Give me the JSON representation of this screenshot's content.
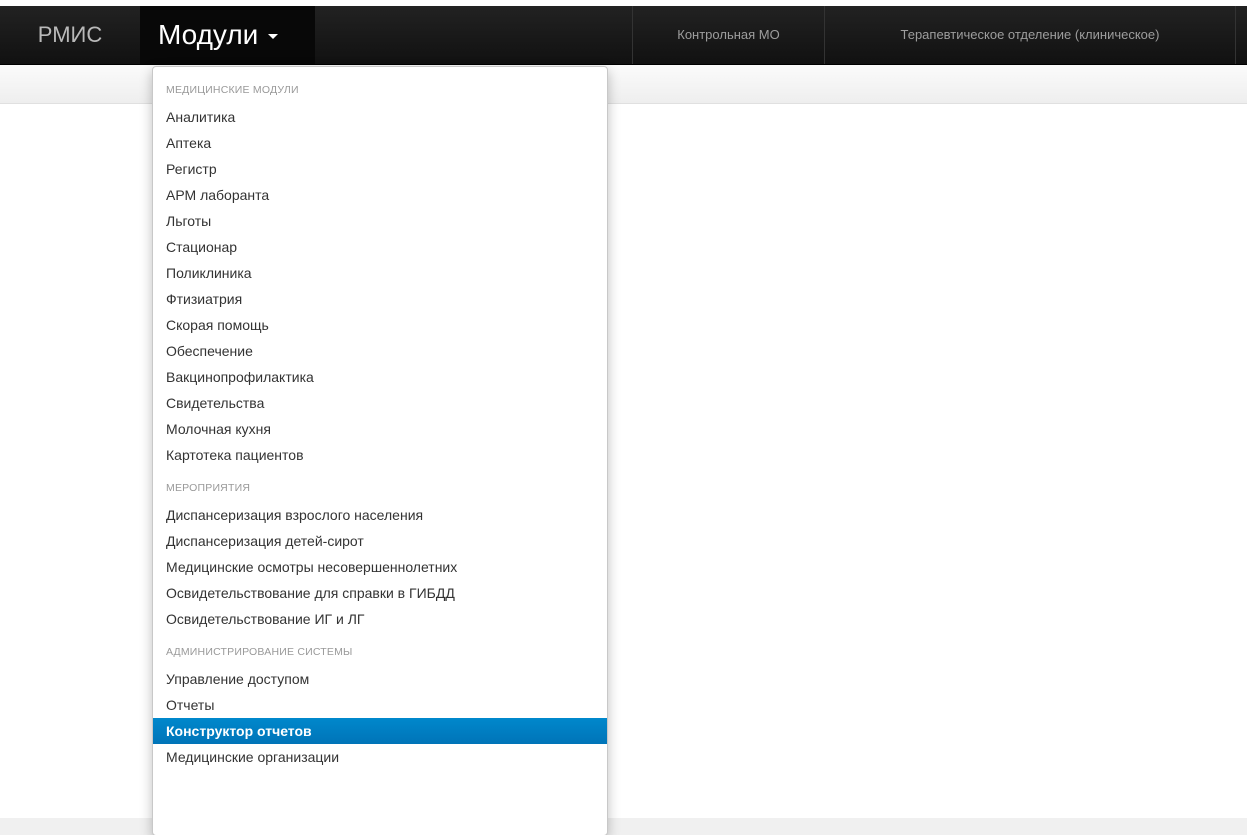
{
  "navbar": {
    "brand": "РМИС",
    "modules_label": "Модули",
    "organization": "Контрольная МО",
    "department": "Терапевтическое отделение (клиническое)"
  },
  "dropdown": {
    "sections": [
      {
        "header": "МЕДИЦИНСКИЕ МОДУЛИ",
        "items": [
          "Аналитика",
          "Аптека",
          "Регистр",
          "АРМ лаборанта",
          "Льготы",
          "Стационар",
          "Поликлиника",
          "Фтизиатрия",
          "Скорая помощь",
          "Обеспечение",
          "Вакцинопрофилактика",
          "Свидетельства",
          "Молочная кухня",
          "Картотека пациентов"
        ]
      },
      {
        "header": "МЕРОПРИЯТИЯ",
        "items": [
          "Диспансеризация взрослого населения",
          "Диспансеризация детей-сирот",
          "Медицинские осмотры несовершеннолетних",
          "Освидетельствование для справки в ГИБДД",
          "Освидетельствование ИГ и ЛГ"
        ]
      },
      {
        "header": "АДМИНИСТРИРОВАНИЕ СИСТЕМЫ",
        "items": [
          "Управление доступом",
          "Отчеты",
          "Конструктор отчетов",
          "Медицинские организации"
        ]
      }
    ],
    "active_item": "Конструктор отчетов"
  },
  "colors": {
    "navbar_bg": "#111111",
    "active_bg": "#0081c2",
    "header_text": "#999999",
    "item_text": "#333333"
  }
}
